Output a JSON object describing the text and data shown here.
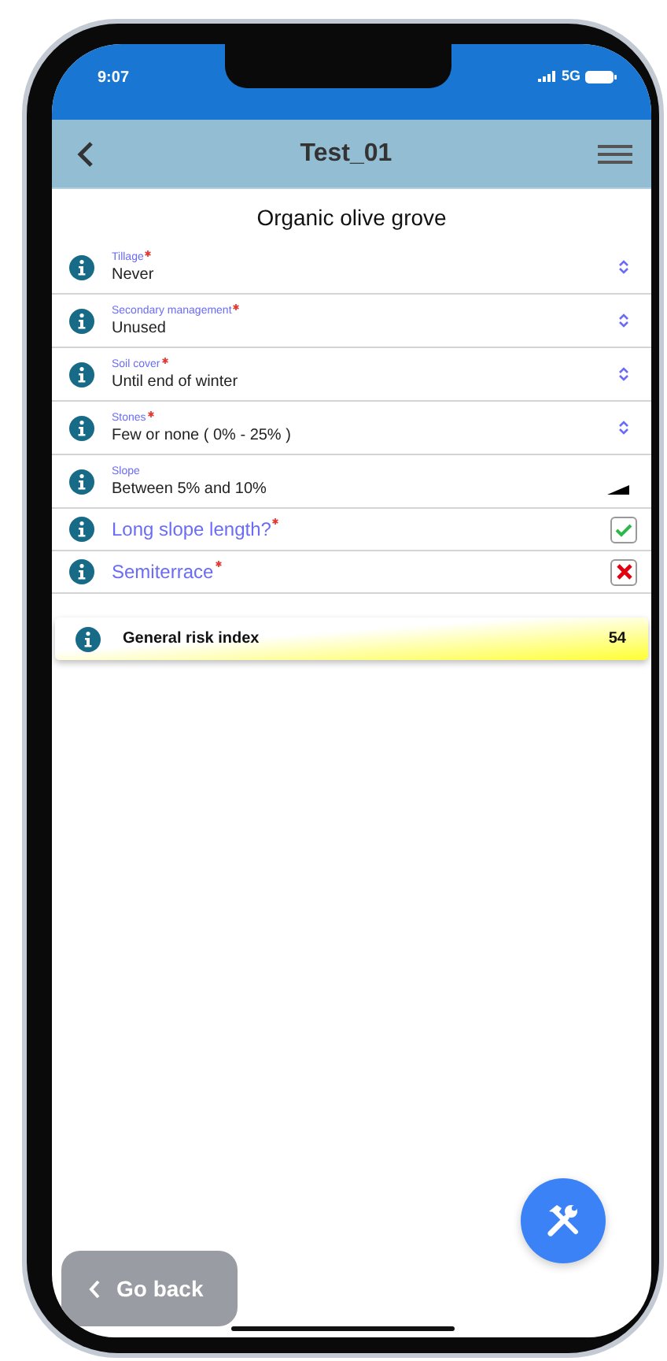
{
  "status_bar": {
    "time": "9:07",
    "network": "5G"
  },
  "header": {
    "title": "Test_01"
  },
  "section_title": "Organic olive grove",
  "fields": [
    {
      "kind": "select",
      "label": "Tillage",
      "required": true,
      "value": "Never"
    },
    {
      "kind": "select",
      "label": "Secondary management",
      "required": true,
      "value": "Unused"
    },
    {
      "kind": "select",
      "label": "Soil cover",
      "required": true,
      "value": "Until end of winter"
    },
    {
      "kind": "select",
      "label": "Stones",
      "required": true,
      "value": "Few or none ( 0% - 25% )"
    },
    {
      "kind": "display",
      "label": "Slope",
      "required": false,
      "value": "Between 5% and 10%"
    },
    {
      "kind": "yes_no",
      "label": "Long slope length?",
      "required": true,
      "yes": true
    },
    {
      "kind": "yes_no",
      "label": "Semiterrace",
      "required": true,
      "yes": false
    }
  ],
  "risk_index": {
    "label": "General risk index",
    "value": "54"
  },
  "go_back_button": {
    "label": "Go back"
  }
}
